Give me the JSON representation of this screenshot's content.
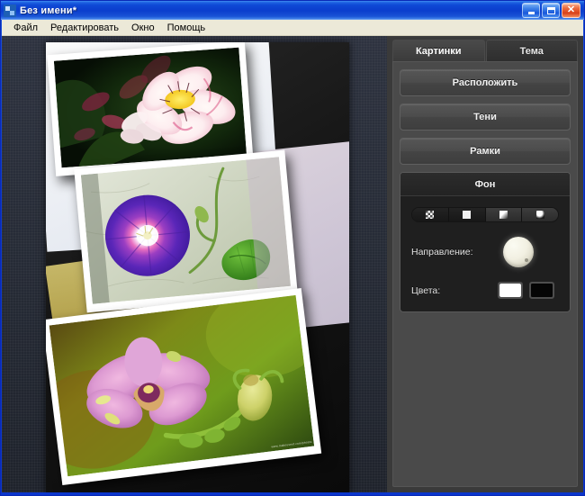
{
  "window": {
    "title": "Без имени*",
    "icon": "app-icon",
    "controls": {
      "minimize": "minimize-button",
      "maximize": "maximize-button",
      "close": "close-button",
      "close_glyph": "✕"
    }
  },
  "menubar": {
    "items": [
      {
        "label": "Файл"
      },
      {
        "label": "Редактировать"
      },
      {
        "label": "Окно"
      },
      {
        "label": "Помощь"
      }
    ]
  },
  "workspace": {
    "photos": [
      {
        "name": "alstroemeria-photo",
        "caption": ""
      },
      {
        "name": "morning-glory-photo",
        "caption": ""
      },
      {
        "name": "orchid-photo",
        "caption": "www.makeuseof.com/photos"
      }
    ]
  },
  "panel": {
    "tabs": [
      {
        "label": "Картинки",
        "active": true
      },
      {
        "label": "Тема",
        "active": false
      }
    ],
    "buttons": [
      {
        "label": "Расположить",
        "name": "arrange-button"
      },
      {
        "label": "Тени",
        "name": "shadows-button"
      },
      {
        "label": "Рамки",
        "name": "frames-button"
      }
    ],
    "background_group": {
      "title": "Фон",
      "styles": [
        {
          "name": "checker-style",
          "selected": false
        },
        {
          "name": "solid-style",
          "selected": false
        },
        {
          "name": "linear-gradient-style",
          "selected": true
        },
        {
          "name": "radial-gradient-style",
          "selected": true
        }
      ],
      "direction": {
        "label": "Направление:",
        "control": "direction-knob"
      },
      "colors": {
        "label": "Цвета:",
        "swatches": [
          {
            "name": "color-swatch-white",
            "hex": "#ffffff"
          },
          {
            "name": "color-swatch-black",
            "hex": "#050505"
          }
        ]
      }
    }
  },
  "theme": {
    "titlebar_blue": "#0b3ecd",
    "menubar_bg": "#ece9d8",
    "panel_bg": "#4a4a4a",
    "group_bg": "#1f1f1f",
    "canvas_bg": "#101010"
  }
}
